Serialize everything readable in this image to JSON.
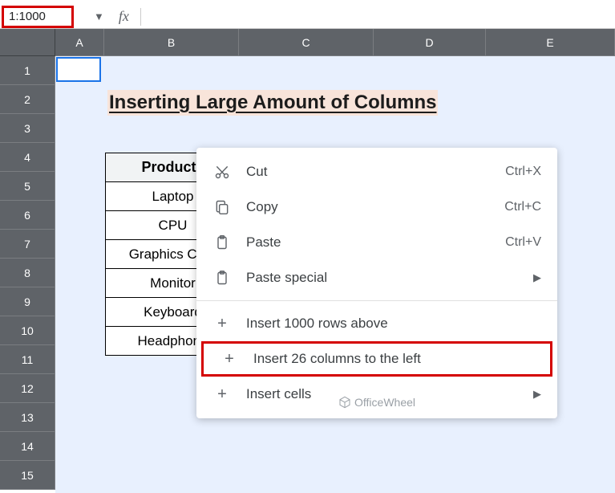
{
  "name_box": "1:1000",
  "fx_label": "fx",
  "columns": [
    "A",
    "B",
    "C",
    "D",
    "E"
  ],
  "rows": [
    "1",
    "2",
    "3",
    "4",
    "5",
    "6",
    "7",
    "8",
    "9",
    "10",
    "11",
    "12",
    "13",
    "14",
    "15"
  ],
  "sheet_title": "Inserting Large Amount of Columns",
  "table": {
    "header": "Products",
    "rows": [
      "Laptop",
      "CPU",
      "Graphics Card",
      "Monitor",
      "Keyboard",
      "Headphone"
    ]
  },
  "context_menu": {
    "cut": {
      "label": "Cut",
      "shortcut": "Ctrl+X"
    },
    "copy": {
      "label": "Copy",
      "shortcut": "Ctrl+C"
    },
    "paste": {
      "label": "Paste",
      "shortcut": "Ctrl+V"
    },
    "paste_special": {
      "label": "Paste special"
    },
    "insert_rows": {
      "label": "Insert 1000 rows above"
    },
    "insert_cols": {
      "label": "Insert 26 columns to the left"
    },
    "insert_cells": {
      "label": "Insert cells"
    }
  },
  "watermark": "OfficeWheel"
}
